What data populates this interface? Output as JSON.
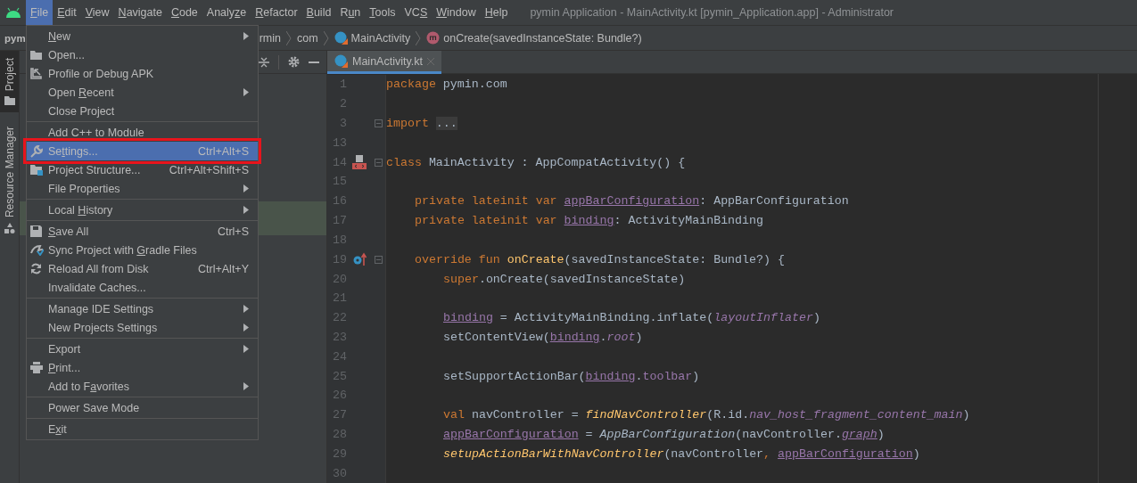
{
  "window": {
    "title": "pymin Application - MainActivity.kt [pymin_Application.app] - Administrator"
  },
  "menu_bar": [
    {
      "parts": [
        {
          "text": "F",
          "underline": true
        },
        {
          "text": "ile",
          "underline": false
        }
      ],
      "selected": true
    },
    {
      "parts": [
        {
          "text": "E",
          "underline": true
        },
        {
          "text": "dit",
          "underline": false
        }
      ],
      "selected": false
    },
    {
      "parts": [
        {
          "text": "V",
          "underline": true
        },
        {
          "text": "iew",
          "underline": false
        }
      ],
      "selected": false
    },
    {
      "parts": [
        {
          "text": "N",
          "underline": true
        },
        {
          "text": "avigate",
          "underline": false
        }
      ],
      "selected": false
    },
    {
      "parts": [
        {
          "text": "C",
          "underline": true
        },
        {
          "text": "ode",
          "underline": false
        }
      ],
      "selected": false
    },
    {
      "parts": [
        {
          "text": "Analy",
          "underline": false
        },
        {
          "text": "z",
          "underline": true
        },
        {
          "text": "e",
          "underline": false
        }
      ],
      "selected": false
    },
    {
      "parts": [
        {
          "text": "R",
          "underline": true
        },
        {
          "text": "efactor",
          "underline": false
        }
      ],
      "selected": false
    },
    {
      "parts": [
        {
          "text": "B",
          "underline": true
        },
        {
          "text": "uild",
          "underline": false
        }
      ],
      "selected": false
    },
    {
      "parts": [
        {
          "text": "R",
          "underline": false
        },
        {
          "text": "u",
          "underline": true
        },
        {
          "text": "n",
          "underline": false
        }
      ],
      "selected": false
    },
    {
      "parts": [
        {
          "text": "T",
          "underline": true
        },
        {
          "text": "ools",
          "underline": false
        }
      ],
      "selected": false
    },
    {
      "parts": [
        {
          "text": "VC",
          "underline": false
        },
        {
          "text": "S",
          "underline": true
        }
      ],
      "selected": false
    },
    {
      "parts": [
        {
          "text": "W",
          "underline": true
        },
        {
          "text": "indow",
          "underline": false
        }
      ],
      "selected": false
    },
    {
      "parts": [
        {
          "text": "H",
          "underline": true
        },
        {
          "text": "elp",
          "underline": false
        }
      ],
      "selected": false
    }
  ],
  "breadcrumb": {
    "items": [
      {
        "label": "pym",
        "kind": "text"
      },
      {
        "label": "rmin",
        "kind": "text"
      },
      {
        "label": "com",
        "kind": "text"
      },
      {
        "label": "MainActivity",
        "kind": "class"
      },
      {
        "label": "onCreate(savedInstanceState: Bundle?)",
        "kind": "method"
      }
    ]
  },
  "tool_window_stripe": [
    {
      "label": "Project",
      "selected": true
    },
    {
      "label": "Resource Manager",
      "selected": false
    }
  ],
  "editor": {
    "tabs": [
      {
        "label": "MainActivity.kt",
        "selected": true
      }
    ],
    "lines": [
      {
        "number": "1",
        "tokens": [
          {
            "text": "package",
            "kind": "keyword"
          },
          {
            "text": " pymin.com",
            "kind": "plain"
          }
        ]
      },
      {
        "number": "2"
      },
      {
        "number": "3",
        "fold": true,
        "tokens": [
          {
            "text": "import ",
            "kind": "keyword"
          },
          {
            "text": "...",
            "kind": "folded"
          }
        ]
      },
      {
        "number": "13"
      },
      {
        "number": "14",
        "kind": "class",
        "fold": true,
        "tokens": [
          {
            "text": "class",
            "kind": "keyword"
          },
          {
            "text": " MainActivity : AppCompatActivity() {",
            "kind": "plain"
          }
        ],
        "children": [
          {
            "number": "15"
          },
          {
            "number": "16",
            "tokens": [
              {
                "text": "private lateinit var ",
                "kind": "keyword"
              },
              {
                "text": "appBarConfiguration",
                "kind": "ref"
              },
              {
                "text": ": AppBarConfiguration",
                "kind": "plain"
              }
            ]
          },
          {
            "number": "17",
            "tokens": [
              {
                "text": "private lateinit var ",
                "kind": "keyword"
              },
              {
                "text": "binding",
                "kind": "ref"
              },
              {
                "text": ": ActivityMainBinding",
                "kind": "plain"
              }
            ]
          },
          {
            "number": "18"
          },
          {
            "number": "19",
            "kind": "override",
            "fold": true,
            "tokens": [
              {
                "text": "override fun ",
                "kind": "keyword"
              },
              {
                "text": "onCreate",
                "kind": "function"
              },
              {
                "text": "(savedInstanceState: Bundle?) {",
                "kind": "plain"
              }
            ],
            "children": [
              {
                "number": "20",
                "tokens": [
                  {
                    "text": "super",
                    "kind": "keyword"
                  },
                  {
                    "text": ".onCreate(savedInstanceState)",
                    "kind": "plain"
                  }
                ]
              },
              {
                "number": "21"
              },
              {
                "number": "22",
                "tokens": [
                  {
                    "text": "binding",
                    "kind": "ref"
                  },
                  {
                    "text": " = ActivityMainBinding.inflate(",
                    "kind": "plain"
                  },
                  {
                    "text": "layoutInflater",
                    "kind": "property_italic"
                  },
                  {
                    "text": ")",
                    "kind": "plain"
                  }
                ]
              },
              {
                "number": "23",
                "tokens": [
                  {
                    "text": "setContentView(",
                    "kind": "plain"
                  },
                  {
                    "text": "binding",
                    "kind": "ref"
                  },
                  {
                    "text": ".",
                    "kind": "plain"
                  },
                  {
                    "text": "root",
                    "kind": "property_italic"
                  },
                  {
                    "text": ")",
                    "kind": "plain"
                  }
                ]
              },
              {
                "number": "24"
              },
              {
                "number": "25",
                "tokens": [
                  {
                    "text": "setSupportActionBar(",
                    "kind": "plain"
                  },
                  {
                    "text": "binding",
                    "kind": "ref"
                  },
                  {
                    "text": ".",
                    "kind": "plain"
                  },
                  {
                    "text": "toolbar",
                    "kind": "property"
                  },
                  {
                    "text": ")",
                    "kind": "plain"
                  }
                ]
              },
              {
                "number": "26"
              },
              {
                "number": "27",
                "tokens": [
                  {
                    "text": "val",
                    "kind": "keyword"
                  },
                  {
                    "text": " navController = ",
                    "kind": "plain"
                  },
                  {
                    "text": "findNavController",
                    "kind": "function_italic"
                  },
                  {
                    "text": "(R.id.",
                    "kind": "plain"
                  },
                  {
                    "text": "nav_host_fragment_content_main",
                    "kind": "property_italic"
                  },
                  {
                    "text": ")",
                    "kind": "plain"
                  }
                ]
              },
              {
                "number": "28",
                "tokens": [
                  {
                    "text": "appBarConfiguration",
                    "kind": "ref"
                  },
                  {
                    "text": " = ",
                    "kind": "plain"
                  },
                  {
                    "text": "AppBarConfiguration",
                    "kind": "plain_italic"
                  },
                  {
                    "text": "(navController.",
                    "kind": "plain"
                  },
                  {
                    "text": "graph",
                    "kind": "ref_italic"
                  },
                  {
                    "text": ")",
                    "kind": "plain"
                  }
                ]
              },
              {
                "number": "29",
                "tokens": [
                  {
                    "text": "setupActionBarWithNavController",
                    "kind": "function_italic"
                  },
                  {
                    "text": "(navController",
                    "kind": "plain"
                  },
                  {
                    "text": ", ",
                    "kind": "keyword"
                  },
                  {
                    "text": "appBarConfiguration",
                    "kind": "ref"
                  },
                  {
                    "text": ")",
                    "kind": "plain"
                  }
                ]
              },
              {
                "number": "30"
              }
            ]
          }
        ]
      }
    ]
  },
  "file_menu": {
    "groups": [
      {
        "items": [
          {
            "kind": "plain",
            "parts": [
              {
                "text": "N",
                "underline": true
              },
              {
                "text": "ew",
                "underline": false
              }
            ],
            "submenu": true,
            "selected": false
          },
          {
            "kind": "folder",
            "parts": [
              {
                "text": "Open...",
                "underline": false
              }
            ],
            "submenu": false,
            "selected": false
          },
          {
            "kind": "profile",
            "parts": [
              {
                "text": "Profile or Debug APK",
                "underline": false
              }
            ],
            "submenu": false,
            "selected": false
          },
          {
            "kind": "plain",
            "parts": [
              {
                "text": "Open ",
                "underline": false
              },
              {
                "text": "R",
                "underline": true
              },
              {
                "text": "ecent",
                "underline": false
              }
            ],
            "submenu": true,
            "selected": false
          },
          {
            "kind": "plain",
            "parts": [
              {
                "text": "Close Project",
                "underline": false
              }
            ],
            "submenu": false,
            "selected": false
          }
        ]
      },
      {
        "items": [
          {
            "kind": "plain",
            "parts": [
              {
                "text": "Add C++ to Module",
                "underline": false
              }
            ],
            "submenu": false,
            "selected": false
          },
          {
            "kind": "wrench",
            "parts": [
              {
                "text": "Se",
                "underline": false
              },
              {
                "text": "t",
                "underline": true
              },
              {
                "text": "tings...",
                "underline": false
              }
            ],
            "shortcut": "Ctrl+Alt+S",
            "submenu": false,
            "selected": true,
            "highlighted": true
          },
          {
            "kind": "structure",
            "parts": [
              {
                "text": "Project Structure...",
                "underline": false
              }
            ],
            "shortcut": "Ctrl+Alt+Shift+S",
            "submenu": false,
            "selected": false
          },
          {
            "kind": "plain",
            "parts": [
              {
                "text": "File Properties",
                "underline": false
              }
            ],
            "submenu": true,
            "selected": false
          }
        ]
      },
      {
        "items": [
          {
            "kind": "plain",
            "parts": [
              {
                "text": "Local ",
                "underline": false
              },
              {
                "text": "H",
                "underline": true
              },
              {
                "text": "istory",
                "underline": false
              }
            ],
            "submenu": true,
            "selected": false
          }
        ]
      },
      {
        "items": [
          {
            "kind": "save",
            "parts": [
              {
                "text": "S",
                "underline": true
              },
              {
                "text": "ave All",
                "underline": false
              }
            ],
            "shortcut": "Ctrl+S",
            "submenu": false,
            "selected": false
          },
          {
            "kind": "sync",
            "parts": [
              {
                "text": "Sync Project with ",
                "underline": false
              },
              {
                "text": "G",
                "underline": true
              },
              {
                "text": "radle Files",
                "underline": false
              }
            ],
            "submenu": false,
            "selected": false
          },
          {
            "kind": "reload",
            "parts": [
              {
                "text": "Reload All from Disk",
                "underline": false
              }
            ],
            "shortcut": "Ctrl+Alt+Y",
            "submenu": false,
            "selected": false
          },
          {
            "kind": "plain",
            "parts": [
              {
                "text": "Invalidate Caches...",
                "underline": false
              }
            ],
            "submenu": false,
            "selected": false
          }
        ]
      },
      {
        "items": [
          {
            "kind": "plain",
            "parts": [
              {
                "text": "Manage IDE Settings",
                "underline": false
              }
            ],
            "submenu": true,
            "selected": false
          },
          {
            "kind": "plain",
            "parts": [
              {
                "text": "New Projects Settings",
                "underline": false
              }
            ],
            "submenu": true,
            "selected": false
          }
        ]
      },
      {
        "items": [
          {
            "kind": "plain",
            "parts": [
              {
                "text": "Export",
                "underline": false
              }
            ],
            "submenu": true,
            "selected": false
          },
          {
            "kind": "print",
            "parts": [
              {
                "text": "P",
                "underline": true
              },
              {
                "text": "rint...",
                "underline": false
              }
            ],
            "submenu": false,
            "selected": false
          },
          {
            "kind": "plain",
            "parts": [
              {
                "text": "Add to F",
                "underline": false
              },
              {
                "text": "a",
                "underline": true
              },
              {
                "text": "vorites",
                "underline": false
              }
            ],
            "submenu": true,
            "selected": false
          }
        ]
      },
      {
        "items": [
          {
            "kind": "plain",
            "parts": [
              {
                "text": "Power Save Mode",
                "underline": false
              }
            ],
            "submenu": false,
            "selected": false
          }
        ]
      },
      {
        "items": [
          {
            "kind": "plain",
            "parts": [
              {
                "text": "E",
                "underline": false
              },
              {
                "text": "x",
                "underline": true
              },
              {
                "text": "it",
                "underline": false
              }
            ],
            "submenu": false,
            "selected": false
          }
        ]
      }
    ]
  }
}
